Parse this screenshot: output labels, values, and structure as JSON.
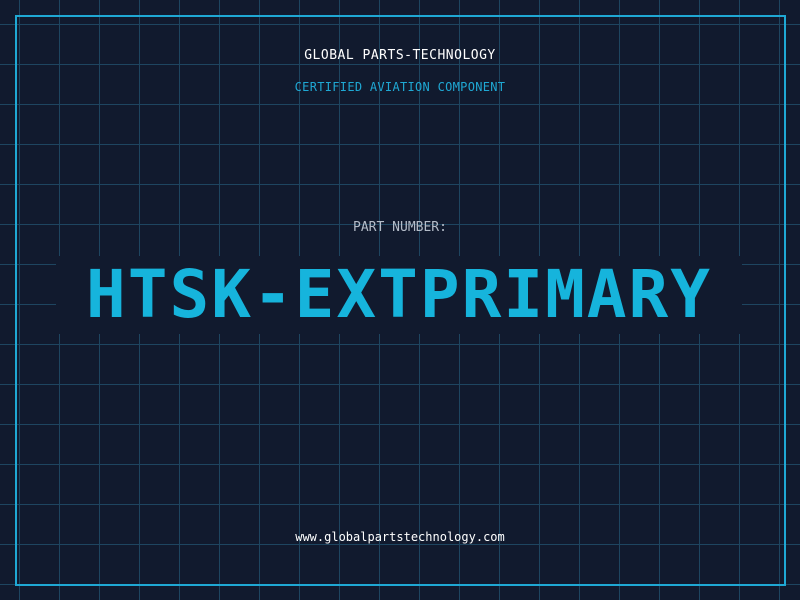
{
  "header": {
    "company": "GLOBAL PARTS-TECHNOLOGY",
    "tagline": "CERTIFIED AVIATION COMPONENT"
  },
  "part": {
    "label": "PART NUMBER:",
    "number": "HTSK-EXTPRIMARY"
  },
  "footer": {
    "website": "www.globalpartstechnology.com"
  },
  "colors": {
    "background": "#111a2e",
    "grid": "#1e4560",
    "accent": "#1fa8d4",
    "part_number": "#16b4dc",
    "label": "#b4bcc8",
    "text": "#ffffff"
  }
}
